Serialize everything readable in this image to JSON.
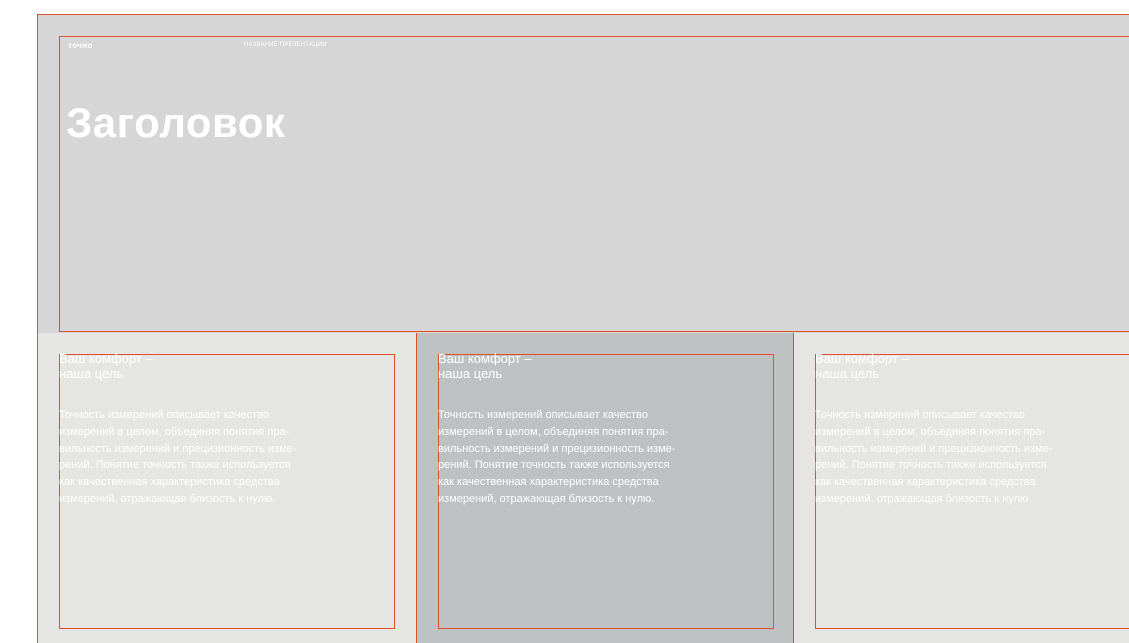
{
  "slide": {
    "brand": "точно",
    "presentation_name": "НАЗВАНИЕ ПРЕЗЕНТАЦИИ",
    "title": "Заголовок"
  },
  "cards": [
    {
      "heading": "Ваш комфорт –\nнаша цель",
      "lines": [
        "Точность измерений описывает качество",
        "измерений в целом, объединяя понятия пра-",
        "вильность измерений и прецизионность изме-",
        "рений. Понятие точность также используется",
        "как качественная характеристика средства",
        "измерений, отражающая близость к нулю."
      ]
    },
    {
      "heading": "Ваш комфорт –\nнаша цель",
      "lines": [
        "Точность измерений описывает качество",
        "измерений в целом, объединяя понятия пра-",
        "вильность измерений и прецизионность изме-",
        "рений. Понятие точность также используется",
        "как качественная характеристика средства",
        "измерений, отражающая близость к нулю."
      ]
    },
    {
      "heading": "Ваш комфорт –\nнаша цель",
      "lines": [
        "Точность измерений описывает качество",
        "измерений в целом, объединяя понятия пра-",
        "вильность измерений и прецизионность изме-",
        "рений. Понятие точность также используется",
        "как качественная характеристика средства",
        "измерений, отражающая близость к нулю"
      ]
    }
  ],
  "colors": {
    "guide_line": "#e2502a",
    "hero_background": "#d6d6d6",
    "card_background": "#e5e5e4",
    "card_highlight_background": "#bdc1c1",
    "text": "#ffffff"
  }
}
